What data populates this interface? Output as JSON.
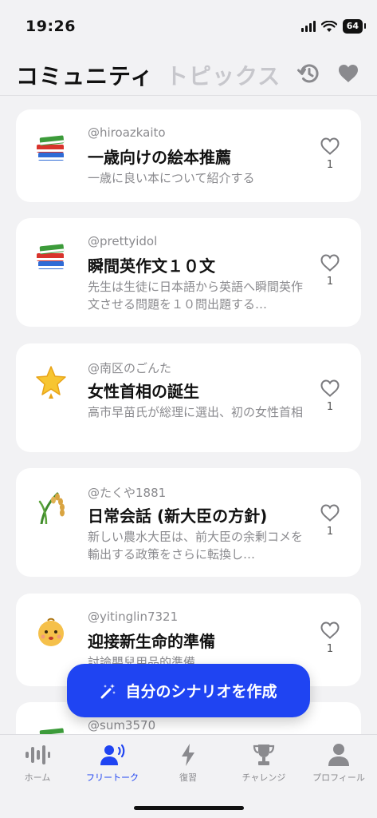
{
  "status_bar": {
    "time": "19:26",
    "battery": "64"
  },
  "header": {
    "tab_active": "コミュニティ",
    "tab_inactive": "トピックス"
  },
  "cards": [
    {
      "emoji": "books",
      "user": "@hiroazkaito",
      "title": "一歳向けの絵本推薦",
      "desc": "一歳に良い本について紹介する",
      "likes": "1"
    },
    {
      "emoji": "books",
      "user": "@prettyidol",
      "title": "瞬間英作文１０文",
      "desc": "先生は生徒に日本語から英語へ瞬間英作文させる問題を１０問出題する…",
      "likes": "1"
    },
    {
      "emoji": "star",
      "user": "@南区のごんた",
      "title": "女性首相の誕生",
      "desc": "高市早苗氏が総理に選出、初の女性首相",
      "likes": "1"
    },
    {
      "emoji": "rice",
      "user": "@たくや1881",
      "title": "日常会話 (新大臣の方針)",
      "desc": "新しい農水大臣は、前大臣の余剰コメを輸出する政策をさらに転換し…",
      "likes": "1"
    },
    {
      "emoji": "baby",
      "user": "@yitinglin7321",
      "title": "迎接新生命的準備",
      "desc": "討論嬰兒用品的準備",
      "likes": "1"
    },
    {
      "emoji": "books",
      "user": "@sum3570",
      "title": "",
      "desc": "",
      "likes": ""
    }
  ],
  "create_button": {
    "label": "自分のシナリオを作成"
  },
  "nav": [
    {
      "label": "ホーム",
      "icon": "waveform-icon"
    },
    {
      "label": "フリートーク",
      "icon": "person-speaking-icon"
    },
    {
      "label": "復習",
      "icon": "bolt-icon"
    },
    {
      "label": "チャレンジ",
      "icon": "trophy-icon"
    },
    {
      "label": "プロフィール",
      "icon": "person-icon"
    }
  ],
  "colors": {
    "accent": "#1f44f2",
    "inactive": "#8a8a8e",
    "background": "#f2f2f4"
  }
}
